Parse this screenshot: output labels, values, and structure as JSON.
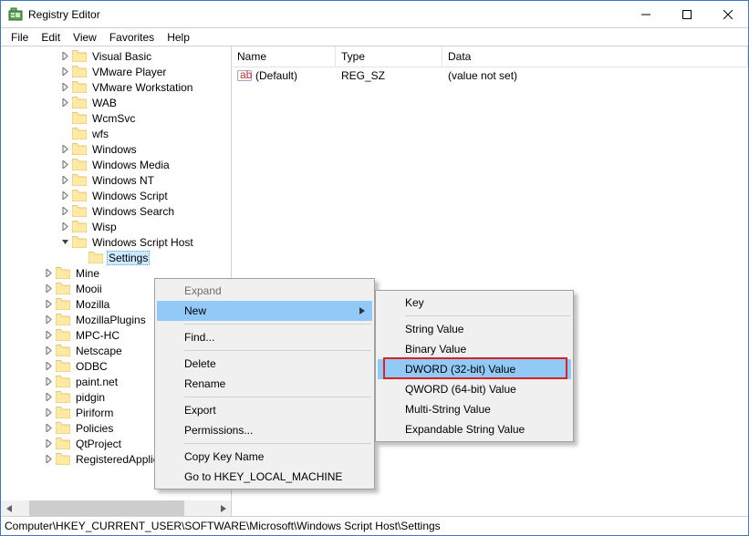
{
  "window": {
    "title": "Registry Editor"
  },
  "menubar": [
    "File",
    "Edit",
    "View",
    "Favorites",
    "Help"
  ],
  "tree": {
    "items": [
      {
        "depth": 3,
        "exp": "closed",
        "label": "Visual Basic"
      },
      {
        "depth": 3,
        "exp": "closed",
        "label": "VMware Player"
      },
      {
        "depth": 3,
        "exp": "closed",
        "label": "VMware Workstation"
      },
      {
        "depth": 3,
        "exp": "closed",
        "label": "WAB"
      },
      {
        "depth": 3,
        "exp": "none",
        "label": "WcmSvc"
      },
      {
        "depth": 3,
        "exp": "none",
        "label": "wfs"
      },
      {
        "depth": 3,
        "exp": "closed",
        "label": "Windows"
      },
      {
        "depth": 3,
        "exp": "closed",
        "label": "Windows Media"
      },
      {
        "depth": 3,
        "exp": "closed",
        "label": "Windows NT"
      },
      {
        "depth": 3,
        "exp": "closed",
        "label": "Windows Script"
      },
      {
        "depth": 3,
        "exp": "closed",
        "label": "Windows Search"
      },
      {
        "depth": 3,
        "exp": "closed",
        "label": "Wisp"
      },
      {
        "depth": 3,
        "exp": "open",
        "label": "Windows Script Host"
      },
      {
        "depth": 4,
        "exp": "none",
        "label": "Settings",
        "selected": true
      },
      {
        "depth": 2,
        "exp": "closed",
        "label": "Mine"
      },
      {
        "depth": 2,
        "exp": "closed",
        "label": "Mooii"
      },
      {
        "depth": 2,
        "exp": "closed",
        "label": "Mozilla"
      },
      {
        "depth": 2,
        "exp": "closed",
        "label": "MozillaPlugins"
      },
      {
        "depth": 2,
        "exp": "closed",
        "label": "MPC-HC"
      },
      {
        "depth": 2,
        "exp": "closed",
        "label": "Netscape"
      },
      {
        "depth": 2,
        "exp": "closed",
        "label": "ODBC"
      },
      {
        "depth": 2,
        "exp": "closed",
        "label": "paint.net"
      },
      {
        "depth": 2,
        "exp": "closed",
        "label": "pidgin"
      },
      {
        "depth": 2,
        "exp": "closed",
        "label": "Piriform"
      },
      {
        "depth": 2,
        "exp": "closed",
        "label": "Policies"
      },
      {
        "depth": 2,
        "exp": "closed",
        "label": "QtProject"
      },
      {
        "depth": 2,
        "exp": "closed",
        "label": "RegisteredApplications"
      }
    ]
  },
  "list": {
    "headers": {
      "name": "Name",
      "type": "Type",
      "data": "Data"
    },
    "rows": [
      {
        "icon": "ab",
        "name": "(Default)",
        "type": "REG_SZ",
        "data": "(value not set)"
      }
    ]
  },
  "ctx1": {
    "items": [
      {
        "label": "Expand",
        "kind": "item",
        "disabled": true
      },
      {
        "label": "New",
        "kind": "item",
        "submenu": true,
        "highlight": true
      },
      {
        "kind": "sep"
      },
      {
        "label": "Find...",
        "kind": "item"
      },
      {
        "kind": "sep"
      },
      {
        "label": "Delete",
        "kind": "item"
      },
      {
        "label": "Rename",
        "kind": "item"
      },
      {
        "kind": "sep"
      },
      {
        "label": "Export",
        "kind": "item"
      },
      {
        "label": "Permissions...",
        "kind": "item"
      },
      {
        "kind": "sep"
      },
      {
        "label": "Copy Key Name",
        "kind": "item"
      },
      {
        "label": "Go to HKEY_LOCAL_MACHINE",
        "kind": "item"
      }
    ]
  },
  "ctx2": {
    "items": [
      {
        "label": "Key",
        "kind": "item"
      },
      {
        "kind": "sep"
      },
      {
        "label": "String Value",
        "kind": "item"
      },
      {
        "label": "Binary Value",
        "kind": "item"
      },
      {
        "label": "DWORD (32-bit) Value",
        "kind": "item",
        "highlight": true
      },
      {
        "label": "QWORD (64-bit) Value",
        "kind": "item"
      },
      {
        "label": "Multi-String Value",
        "kind": "item"
      },
      {
        "label": "Expandable String Value",
        "kind": "item"
      }
    ]
  },
  "statusbar": {
    "path": "Computer\\HKEY_CURRENT_USER\\SOFTWARE\\Microsoft\\Windows Script Host\\Settings"
  }
}
